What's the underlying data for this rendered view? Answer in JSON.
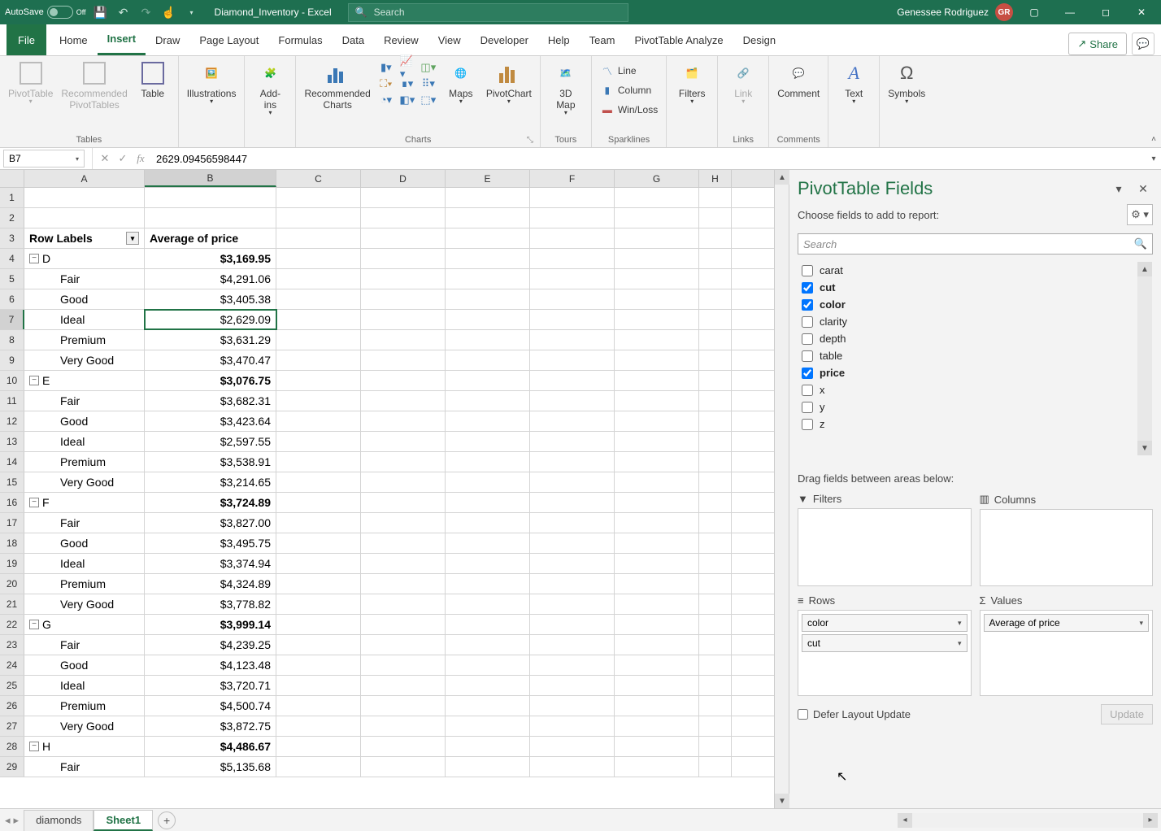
{
  "titlebar": {
    "autosave_label": "AutoSave",
    "autosave_off": "Off",
    "filename": "Diamond_Inventory - Excel",
    "search_placeholder": "Search",
    "user": "Genessee Rodriguez",
    "user_initials": "GR"
  },
  "tabs": {
    "file": "File",
    "list": [
      "Home",
      "Insert",
      "Draw",
      "Page Layout",
      "Formulas",
      "Data",
      "Review",
      "View",
      "Developer",
      "Help",
      "Team",
      "PivotTable Analyze",
      "Design"
    ],
    "active": "Insert",
    "share": "Share"
  },
  "ribbon": {
    "tables": {
      "pivottable": "PivotTable",
      "recommended_pt": "Recommended\nPivotTables",
      "table": "Table",
      "group": "Tables"
    },
    "illustrations": {
      "btn": "Illustrations",
      "group": "Illustrations"
    },
    "addins": {
      "btn": "Add-\nins",
      "group": "Add-ins"
    },
    "charts": {
      "recommended": "Recommended\nCharts",
      "maps": "Maps",
      "pivotchart": "PivotChart",
      "group": "Charts"
    },
    "tours": {
      "btn": "3D\nMap",
      "group": "Tours"
    },
    "sparklines": {
      "line": "Line",
      "column": "Column",
      "winloss": "Win/Loss",
      "group": "Sparklines"
    },
    "filters": {
      "btn": "Filters",
      "group": "Filters"
    },
    "links": {
      "btn": "Link",
      "group": "Links"
    },
    "comments": {
      "btn": "Comment",
      "group": "Comments"
    },
    "text": {
      "btn": "Text",
      "group": "Text"
    },
    "symbols": {
      "btn": "Symbols",
      "group": "Symbols"
    }
  },
  "formulabar": {
    "namebox": "B7",
    "formula": "2629.09456598447"
  },
  "columns": [
    "A",
    "B",
    "C",
    "D",
    "E",
    "F",
    "G",
    "H"
  ],
  "pivot": {
    "row_labels_hdr": "Row Labels",
    "value_hdr": "Average of price",
    "active_cell": "B7",
    "groups": [
      {
        "key": "D",
        "total": "$3,169.95",
        "rows": [
          {
            "label": "Fair",
            "val": "$4,291.06"
          },
          {
            "label": "Good",
            "val": "$3,405.38"
          },
          {
            "label": "Ideal",
            "val": "$2,629.09"
          },
          {
            "label": "Premium",
            "val": "$3,631.29"
          },
          {
            "label": "Very Good",
            "val": "$3,470.47"
          }
        ]
      },
      {
        "key": "E",
        "total": "$3,076.75",
        "rows": [
          {
            "label": "Fair",
            "val": "$3,682.31"
          },
          {
            "label": "Good",
            "val": "$3,423.64"
          },
          {
            "label": "Ideal",
            "val": "$2,597.55"
          },
          {
            "label": "Premium",
            "val": "$3,538.91"
          },
          {
            "label": "Very Good",
            "val": "$3,214.65"
          }
        ]
      },
      {
        "key": "F",
        "total": "$3,724.89",
        "rows": [
          {
            "label": "Fair",
            "val": "$3,827.00"
          },
          {
            "label": "Good",
            "val": "$3,495.75"
          },
          {
            "label": "Ideal",
            "val": "$3,374.94"
          },
          {
            "label": "Premium",
            "val": "$4,324.89"
          },
          {
            "label": "Very Good",
            "val": "$3,778.82"
          }
        ]
      },
      {
        "key": "G",
        "total": "$3,999.14",
        "rows": [
          {
            "label": "Fair",
            "val": "$4,239.25"
          },
          {
            "label": "Good",
            "val": "$4,123.48"
          },
          {
            "label": "Ideal",
            "val": "$3,720.71"
          },
          {
            "label": "Premium",
            "val": "$4,500.74"
          },
          {
            "label": "Very Good",
            "val": "$3,872.75"
          }
        ]
      },
      {
        "key": "H",
        "total": "$4,486.67",
        "rows": [
          {
            "label": "Fair",
            "val": "$5,135.68"
          }
        ]
      }
    ]
  },
  "fieldpane": {
    "title": "PivotTable Fields",
    "subtitle": "Choose fields to add to report:",
    "search": "Search",
    "fields": [
      {
        "name": "carat",
        "checked": false
      },
      {
        "name": "cut",
        "checked": true
      },
      {
        "name": "color",
        "checked": true
      },
      {
        "name": "clarity",
        "checked": false
      },
      {
        "name": "depth",
        "checked": false
      },
      {
        "name": "table",
        "checked": false
      },
      {
        "name": "price",
        "checked": true
      },
      {
        "name": "x",
        "checked": false
      },
      {
        "name": "y",
        "checked": false
      },
      {
        "name": "z",
        "checked": false
      }
    ],
    "drag_label": "Drag fields between areas below:",
    "areas": {
      "filters": "Filters",
      "columns": "Columns",
      "rows": "Rows",
      "values": "Values"
    },
    "rows_chips": [
      "color",
      "cut"
    ],
    "values_chips": [
      "Average of price"
    ],
    "defer": "Defer Layout Update",
    "update": "Update"
  },
  "sheets": {
    "tabs": [
      "diamonds",
      "Sheet1"
    ],
    "active": "Sheet1"
  }
}
